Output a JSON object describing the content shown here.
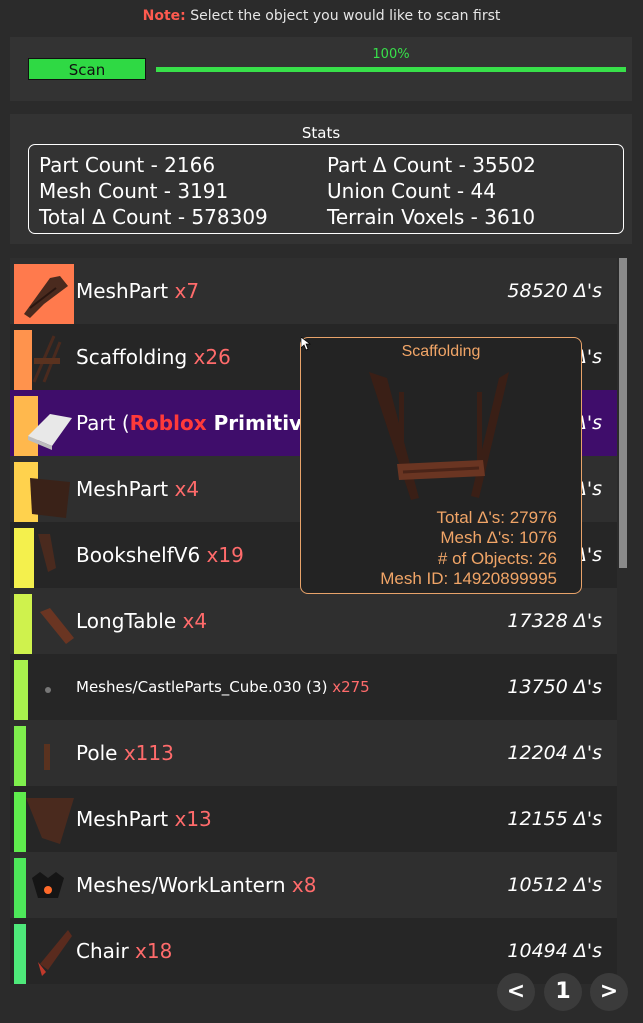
{
  "note": {
    "label": "Note:",
    "text": " Select the object you would like to scan first"
  },
  "scan": {
    "button_label": "Scan",
    "progress_text": "100%",
    "progress": 1.0
  },
  "stats": {
    "title": "Stats",
    "part_count": "Part Count - 2166",
    "part_tri_count": "Part Δ Count - 35502",
    "mesh_count": "Mesh Count - 3191",
    "union_count": "Union Count - 44",
    "total_tri_count": "Total Δ Count - 578309",
    "terrain_voxels": "Terrain Voxels - 3610"
  },
  "items": [
    {
      "name": "MeshPart",
      "count": "x7",
      "tris": "58520 Δ's",
      "color": "#ff7a4d",
      "icon": "meshpart-thumbnail-icon"
    },
    {
      "name": "Scaffolding",
      "count": "x26",
      "tris": "Δ's",
      "color": "#ff934d",
      "icon": "scaffolding-thumbnail-icon"
    },
    {
      "name_pre": "Part (",
      "name_rb": "Roblox",
      "name_post": " Primitive)",
      "tris": "Δ's",
      "color": "#ffb84d",
      "icon": "part-primitive-thumbnail-icon"
    },
    {
      "name": "MeshPart",
      "count": "x4",
      "tris": "Δ's",
      "color": "#ffd24d",
      "icon": "meshpart-thumbnail-icon"
    },
    {
      "name": "BookshelfV6",
      "count": "x19",
      "tris": "Δ's",
      "color": "#f4f04d",
      "icon": "bookshelf-thumbnail-icon"
    },
    {
      "name": "LongTable",
      "count": "x4",
      "tris": "17328 Δ's",
      "color": "#cff24d",
      "icon": "long-table-thumbnail-icon"
    },
    {
      "name": "Meshes/CastleParts_Cube.030 (3)",
      "count": "x275",
      "tris": "13750 Δ's",
      "color": "#a8f24d",
      "icon": "castle-cube-thumbnail-icon"
    },
    {
      "name": "Pole",
      "count": "x113",
      "tris": "12204 Δ's",
      "color": "#7fef4d",
      "icon": "pole-thumbnail-icon"
    },
    {
      "name": "MeshPart",
      "count": "x13",
      "tris": "12155 Δ's",
      "color": "#5fec4d",
      "icon": "meshpart-thumbnail-icon"
    },
    {
      "name": "Meshes/WorkLantern",
      "count": "x8",
      "tris": "10512 Δ's",
      "color": "#4ee85a",
      "icon": "work-lantern-thumbnail-icon"
    },
    {
      "name": "Chair",
      "count": "x18",
      "tris": "10494 Δ's",
      "color": "#4ee87a",
      "icon": "chair-thumbnail-icon"
    }
  ],
  "tooltip": {
    "title": "Scaffolding",
    "total_tris": "Total Δ's: 27976",
    "mesh_tris": "Mesh Δ's: 1076",
    "num_objects": "# of Objects: 26",
    "mesh_id": "Mesh ID: 14920899995"
  },
  "pager": {
    "prev": "<",
    "page": "1",
    "next": ">"
  }
}
